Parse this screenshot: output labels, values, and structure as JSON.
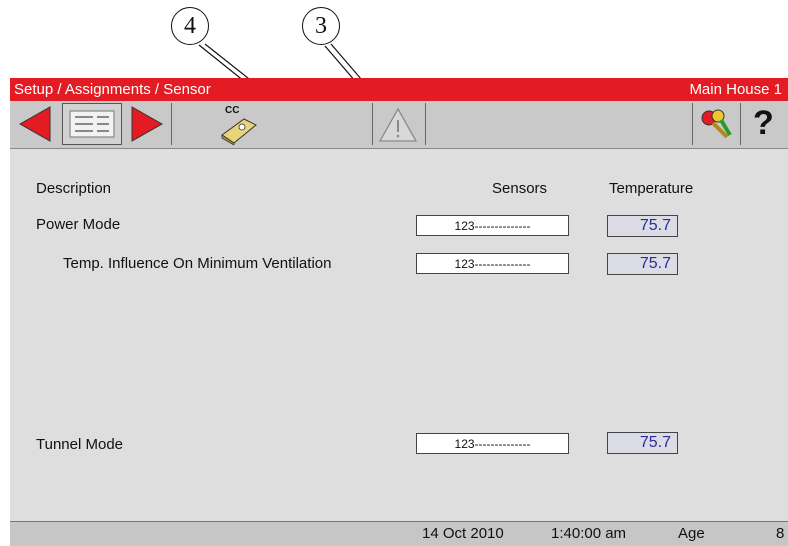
{
  "callouts": {
    "c4": "4",
    "c3": "3"
  },
  "titlebar": {
    "breadcrumb": "Setup / Assignments / Sensor",
    "house": "Main House 1"
  },
  "toolbar": {
    "prev_icon": "red-left-arrow-icon",
    "menu_icon": "list-menu-icon",
    "next_icon": "red-right-arrow-icon",
    "cc_label": "CC",
    "cc_icon": "chicken-coop-icon",
    "alarm_icon": "warning-triangle-icon",
    "keys_icon": "keys-icon",
    "help_label": "?"
  },
  "table": {
    "headers": {
      "description": "Description",
      "sensors": "Sensors",
      "temperature": "Temperature"
    },
    "rows": [
      {
        "label": "Power Mode",
        "sensors": "123--------------",
        "temp": "75.7"
      },
      {
        "label": "Temp. Influence On Minimum Ventilation",
        "sensors": "123--------------",
        "temp": "75.7"
      },
      {
        "label": "Tunnel Mode",
        "sensors": "123--------------",
        "temp": "75.7"
      }
    ]
  },
  "status": {
    "date": "14 Oct 2010",
    "time": "1:40:00 am",
    "age_label": "Age",
    "age_value": "8"
  },
  "colors": {
    "title_red": "#e31b23",
    "temp_blue": "#2a2a9a",
    "screen_gray": "#dedede"
  }
}
